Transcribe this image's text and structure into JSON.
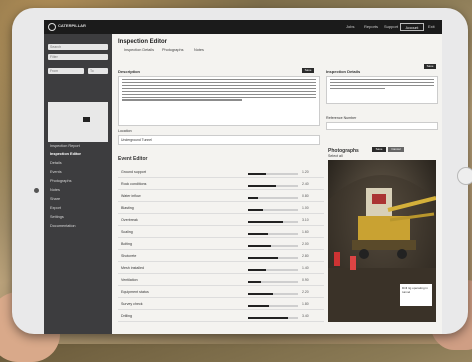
{
  "topbar": {
    "logo_text": "CATERPILLAR",
    "links": [
      "Jobs",
      "Reports",
      "Support"
    ],
    "account_button": "Account",
    "close": "Exit"
  },
  "sidebar": {
    "search_placeholder": "Search",
    "filter_placeholder": "Filter",
    "date_fields": [
      "From",
      "To"
    ],
    "items": [
      {
        "label": "Inspection Report",
        "active": false
      },
      {
        "label": "Inspection Editor",
        "active": true
      },
      {
        "label": "Details",
        "active": false
      },
      {
        "label": "Events",
        "active": false
      },
      {
        "label": "Photographs",
        "active": false
      },
      {
        "label": "Notes",
        "active": false
      },
      {
        "label": "Share",
        "active": false
      },
      {
        "label": "Export",
        "active": false
      },
      {
        "label": "Settings",
        "active": false
      },
      {
        "label": "Documentation",
        "active": false
      }
    ]
  },
  "main": {
    "title": "Inspection Editor",
    "tabs": [
      "Inspection Details",
      "Photographs",
      "Notes"
    ],
    "description_label": "Description",
    "description_right_label": "Inspection Details",
    "location_label": "Location",
    "location_value": "Underground Tunnel",
    "secondary_label": "Reference Number",
    "action_buttons": [
      "Save",
      "Cancel"
    ],
    "event_editor_title": "Event Editor",
    "photographs_title": "Photographs",
    "photo_filter": "Select all",
    "photo_caption": "Drill rig operating in tunnel"
  },
  "event_rows": [
    {
      "label": "Ground support",
      "value": "1.20",
      "level": 0.35
    },
    {
      "label": "Rock conditions",
      "value": "2.40",
      "level": 0.55
    },
    {
      "label": "Water inflow",
      "value": "0.80",
      "level": 0.2
    },
    {
      "label": "Blasting",
      "value": "1.00",
      "level": 0.3
    },
    {
      "label": "Overbreak",
      "value": "3.10",
      "level": 0.7
    },
    {
      "label": "Scaling",
      "value": "1.60",
      "level": 0.4
    },
    {
      "label": "Bolting",
      "value": "2.00",
      "level": 0.45
    },
    {
      "label": "Shotcrete",
      "value": "2.80",
      "level": 0.6
    },
    {
      "label": "Mesh installed",
      "value": "1.40",
      "level": 0.35
    },
    {
      "label": "Ventilation",
      "value": "0.90",
      "level": 0.25
    },
    {
      "label": "Equipment status",
      "value": "2.20",
      "level": 0.5
    },
    {
      "label": "Survey check",
      "value": "1.80",
      "level": 0.42
    },
    {
      "label": "Drilling",
      "value": "3.40",
      "level": 0.8
    }
  ],
  "colors": {
    "sidebar": "#3d3d3f",
    "topbar": "#1b1b1b",
    "accent": "#222222"
  }
}
